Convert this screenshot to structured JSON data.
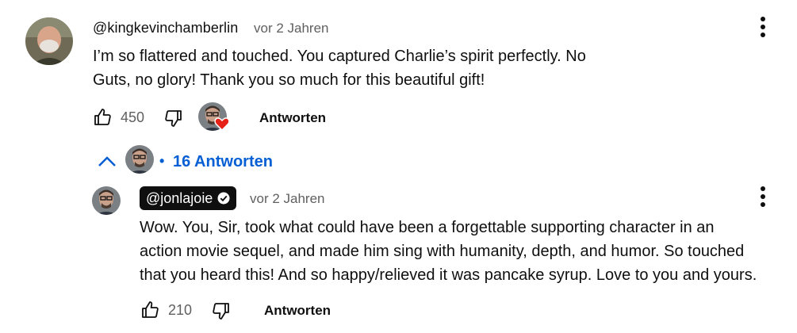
{
  "comment": {
    "author": "@kingkevinchamberlin",
    "time": "vor 2 Jahren",
    "text_line1": "I’m so flattered and touched. You captured Charlie’s spirit perfectly. No",
    "text_line2": "Guts, no glory! Thank you so much for this beautiful gift!",
    "likes": "450",
    "reply_label": "Antworten",
    "replies_count_label": "16 Antworten",
    "bullet": "•"
  },
  "reply": {
    "author": "@jonlajoie",
    "time": "vor 2 Jahren",
    "text_line1": "Wow. You, Sir, took what could have been a forgettable supporting character in an",
    "text_line2": "action movie sequel, and made him sing with humanity, depth, and humor. So touched",
    "text_line3": "that you heard this! And so happy/relieved it was pancake syrup. Love to you and yours.",
    "likes": "210",
    "reply_label": "Antworten"
  },
  "colors": {
    "link_blue": "#065fd4",
    "heart_red": "#e62117",
    "secondary_text": "#606060"
  },
  "icons": [
    "thumbs-up-icon",
    "thumbs-down-icon",
    "heart-icon",
    "chevron-up-icon",
    "more-vert-icon",
    "verified-check-icon"
  ]
}
